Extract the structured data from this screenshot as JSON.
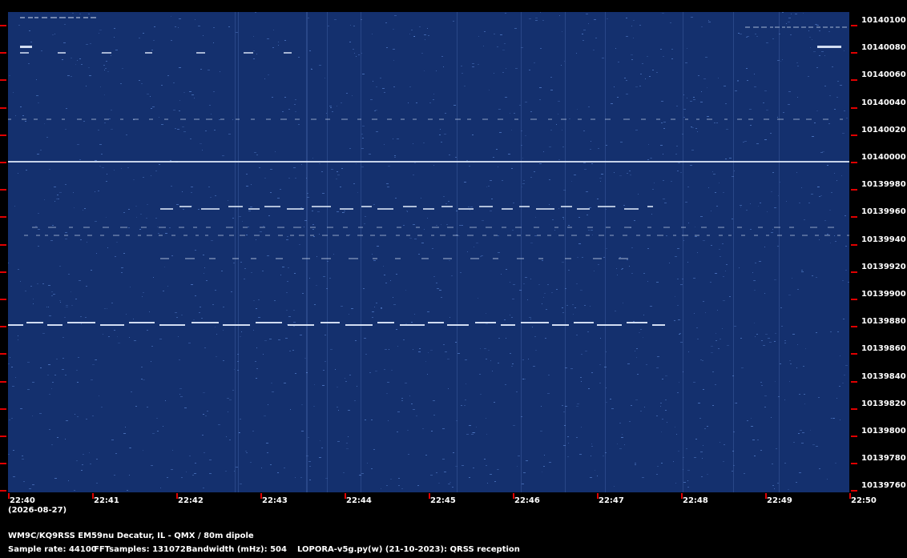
{
  "spectrogram": {
    "frequency_labels": [
      "10140100",
      "10140080",
      "10140060",
      "10140040",
      "10140020",
      "10140000",
      "10139980",
      "10139960",
      "10139940",
      "10139920",
      "10139900",
      "10139880",
      "10139860",
      "10139840",
      "10139820",
      "10139800",
      "10139780",
      "10139760"
    ],
    "time_labels": [
      "22:40",
      "22:41",
      "22:42",
      "22:43",
      "22:44",
      "22:45",
      "22:46",
      "22:47",
      "22:48",
      "22:49",
      "22:50"
    ],
    "date_label": "(2026-08-27)",
    "colors": {
      "background": "#14306e",
      "signal": "#e6f0ff",
      "tick": "#e00000"
    }
  },
  "footer": {
    "station": "WM9C/KQ9RSS EM59nu Decatur, IL - QMX / 80m dipole",
    "sample_rate": "Sample rate: 44100",
    "fft_samples": "FFTsamples: 131072",
    "bandwidth": "Bandwidth (mHz): 504",
    "software": "LOPORA-v5g.py(w) (21-10-2023): QRSS reception"
  }
}
